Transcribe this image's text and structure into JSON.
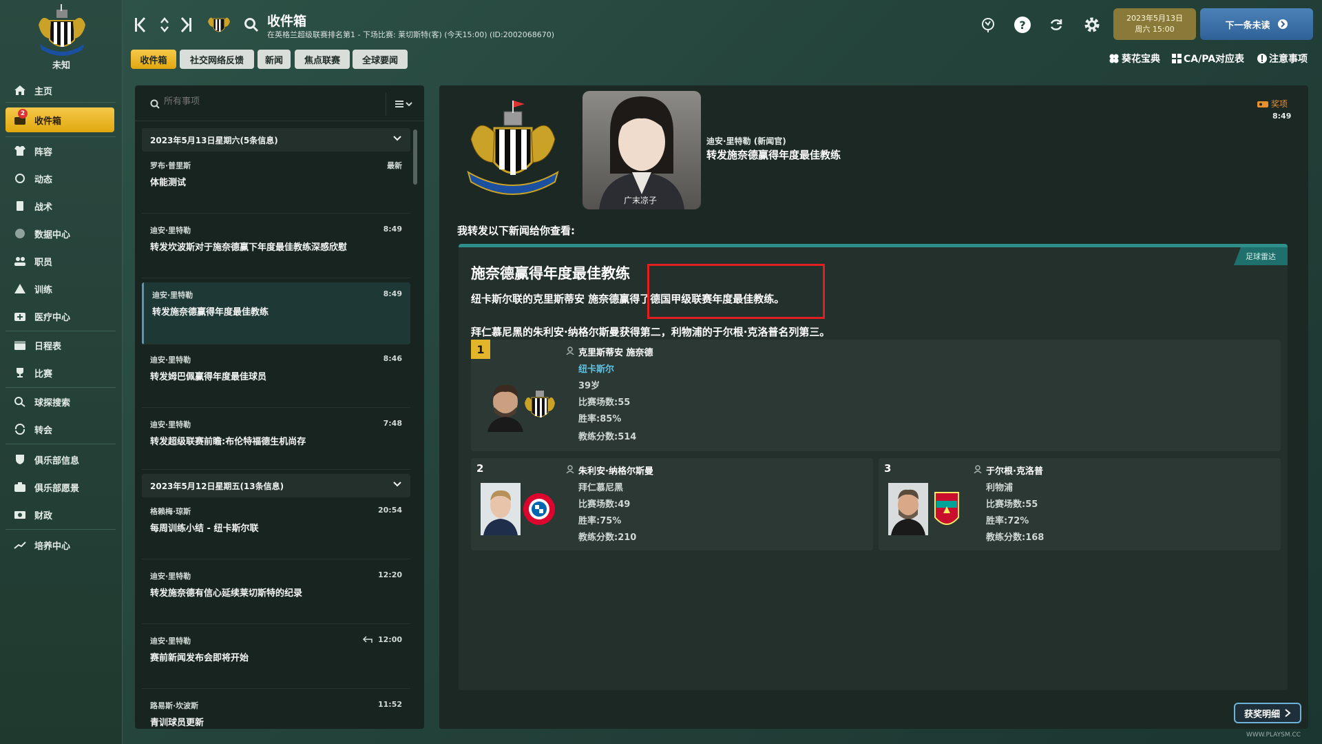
{
  "sidebar": {
    "club_status": "未知",
    "inbox_badge": "2",
    "items": [
      {
        "label": "主页",
        "icon": "home-icon"
      },
      {
        "label": "收件箱",
        "icon": "inbox-icon"
      },
      {
        "label": "阵容",
        "icon": "shirt-icon"
      },
      {
        "label": "动态",
        "icon": "dynamics-icon"
      },
      {
        "label": "战术",
        "icon": "tactics-icon"
      },
      {
        "label": "数据中心",
        "icon": "data-icon"
      },
      {
        "label": "职员",
        "icon": "staff-icon"
      },
      {
        "label": "训练",
        "icon": "training-icon"
      },
      {
        "label": "医疗中心",
        "icon": "medical-icon"
      },
      {
        "label": "日程表",
        "icon": "calendar-icon"
      },
      {
        "label": "比赛",
        "icon": "trophy-icon"
      },
      {
        "label": "球探搜索",
        "icon": "search-icon"
      },
      {
        "label": "转会",
        "icon": "transfer-icon"
      },
      {
        "label": "俱乐部信息",
        "icon": "shield-icon"
      },
      {
        "label": "俱乐部愿景",
        "icon": "vision-icon"
      },
      {
        "label": "财政",
        "icon": "finance-icon"
      },
      {
        "label": "培养中心",
        "icon": "development-icon"
      }
    ]
  },
  "header": {
    "title": "收件箱",
    "subtitle": "在英格兰超级联赛排名第1 - 下场比赛: 莱切斯特(客) (今天15:00) (ID:2002068670)",
    "date_line1": "2023年5月13日",
    "date_line2": "周六 15:00",
    "next_button": "下一条未读",
    "utilities": [
      "葵花宝典",
      "CA/PA对应表",
      "注意事项"
    ]
  },
  "tabs": [
    "收件箱",
    "社交网络反馈",
    "新闻",
    "焦点联赛",
    "全球要闻"
  ],
  "list": {
    "search_placeholder": "所有事项",
    "groups": [
      {
        "header": "2023年5月13日星期六(5条信息)"
      },
      {
        "header": "2023年5月12日星期五(13条信息)"
      }
    ],
    "messages": [
      {
        "sender": "罗布·普里斯",
        "subject": "体能测试",
        "time": "最新"
      },
      {
        "sender": "迪安·里特勒",
        "subject": "转发坎波斯对于施奈德赢下年度最佳教练深感欣慰",
        "time": "8:49"
      },
      {
        "sender": "迪安·里特勒",
        "subject": "转发施奈德赢得年度最佳教练",
        "time": "8:49"
      },
      {
        "sender": "迪安·里特勒",
        "subject": "转发姆巴佩赢得年度最佳球员",
        "time": "8:46"
      },
      {
        "sender": "迪安·里特勒",
        "subject": "转发超级联赛前瞻:布伦特福德生机尚存",
        "time": "7:48"
      },
      {
        "sender": "格赖梅·琼斯",
        "subject": "每周训练小结 - 纽卡斯尔联",
        "time": "20:54"
      },
      {
        "sender": "迪安·里特勒",
        "subject": "转发施奈德有信心延续莱切斯特的纪录",
        "time": "12:20"
      },
      {
        "sender": "迪安·里特勒",
        "subject": "赛前新闻发布会即将开始",
        "time": "12:00"
      },
      {
        "sender": "路易斯·坎波斯",
        "subject": "青训球员更新",
        "time": "11:52"
      }
    ]
  },
  "detail": {
    "sender": "迪安·里特勒 (新闻官)",
    "subject": "转发施奈德赢得年度最佳教练",
    "portrait_caption": "广末凉子",
    "tag": "奖项",
    "time": "8:49",
    "intro": "我转发以下新闻给你查看:",
    "source_tag": "足球雷达",
    "headline": "施奈德赢得年度最佳教练",
    "para1": "纽卡斯尔联的克里斯蒂安 施奈德赢得了德国甲级联赛年度最佳教练。",
    "para2": "拜仁慕尼黑的朱利安·纳格尔斯曼获得第二，利物浦的于尔根·克洛普名列第三。",
    "award_details_button": "获奖明细",
    "watermark": "WWW.PLAYSM.CC",
    "places": [
      {
        "rank": "1",
        "name": "克里斯蒂安 施奈德",
        "club": "纽卡斯尔",
        "age": "39岁",
        "matches": "比赛场数:55",
        "win_rate": "胜率:85%",
        "score": "教练分数:514"
      },
      {
        "rank": "2",
        "name": "朱利安·纳格尔斯曼",
        "club": "拜仁慕尼黑",
        "matches": "比赛场数:49",
        "win_rate": "胜率:75%",
        "score": "教练分数:210"
      },
      {
        "rank": "3",
        "name": "于尔根·克洛普",
        "club": "利物浦",
        "matches": "比赛场数:55",
        "win_rate": "胜率:72%",
        "score": "教练分数:168"
      }
    ]
  },
  "colors": {
    "accent": "#f5c84a",
    "teal": "#2f8f8a",
    "link": "#5fc3e4",
    "highlight": "#e02020"
  }
}
